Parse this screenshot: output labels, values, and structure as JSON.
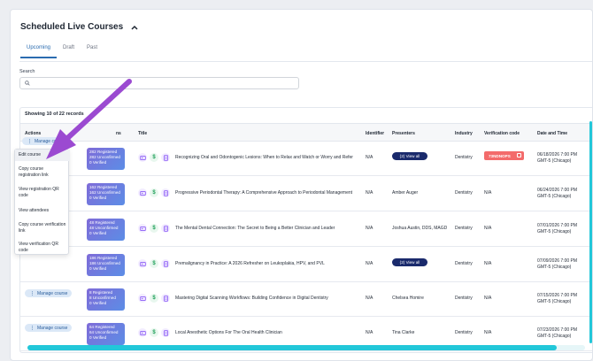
{
  "header": {
    "title": "Scheduled Live Courses"
  },
  "tabs": [
    {
      "label": "Upcoming"
    },
    {
      "label": "Draft"
    },
    {
      "label": "Past"
    }
  ],
  "search": {
    "label": "Search",
    "placeholder": ""
  },
  "table": {
    "showing": "Showing 10 of 22 records",
    "columns": [
      "Actions",
      "Title",
      "Identifier",
      "Presenters",
      "Industry",
      "Verification code",
      "Date and Time"
    ],
    "partial_header": "ns",
    "manage_label": "Manage course",
    "view_all_label": "(2) View all",
    "rows": [
      {
        "registered": "282 Registered",
        "unconfirmed": "282 Unconfirmed",
        "verified": "0 Verified",
        "title": "Recognizing Oral and Odontogenic Lesions: When to Relax and Watch or Worry and Refer",
        "identifier": "N/A",
        "presenters": "",
        "view_all": true,
        "industry": "Dentistry",
        "verification": "73NDNOPS",
        "verification_badge": true,
        "date": "06/18/2026 7:00 PM",
        "tz": "GMT-5 (Chicago)"
      },
      {
        "registered": "162 Registered",
        "unconfirmed": "162 Unconfirmed",
        "verified": "0 Verified",
        "title": "Progressive Periodontal Therapy: A Comprehensive Approach to Periodontal Management",
        "identifier": "N/A",
        "presenters": "Amber Auger",
        "view_all": false,
        "industry": "Dentistry",
        "verification": "N/A",
        "verification_badge": false,
        "date": "06/24/2026 7:00 PM",
        "tz": "GMT-5 (Chicago)"
      },
      {
        "registered": "48 Registered",
        "unconfirmed": "48 Unconfirmed",
        "verified": "0 Verified",
        "title": "The Mental Dental Connection: The Secret to Being a Better Clinician and Leader",
        "identifier": "N/A",
        "presenters": "Joshua Austin, DDS, MAGD",
        "view_all": false,
        "industry": "Dentistry",
        "verification": "N/A",
        "verification_badge": false,
        "date": "07/01/2026 7:00 PM",
        "tz": "GMT-5 (Chicago)"
      },
      {
        "registered": "186 Registered",
        "unconfirmed": "186 Unconfirmed",
        "verified": "0 Verified",
        "title": "Premalignancy in Practice: A 2026 Refresher on Leukoplakia, HPV, and PVL",
        "identifier": "N/A",
        "presenters": "",
        "view_all": true,
        "industry": "Dentistry",
        "verification": "N/A",
        "verification_badge": false,
        "date": "07/09/2026 7:00 PM",
        "tz": "GMT-5 (Chicago)"
      },
      {
        "registered": "8 Registered",
        "unconfirmed": "8 Unconfirmed",
        "verified": "0 Verified",
        "title": "Mastering Digital Scanning Workflows: Building Confidence in Digital Dentistry",
        "identifier": "N/A",
        "presenters": "Chelsea Homire",
        "view_all": false,
        "industry": "Dentistry",
        "verification": "N/A",
        "verification_badge": false,
        "date": "07/15/2026 7:00 PM",
        "tz": "GMT-5 (Chicago)"
      },
      {
        "registered": "64 Registered",
        "unconfirmed": "64 Unconfirmed",
        "verified": "0 Verified",
        "title": "Local Anesthetic Options For The Oral Health Clinician",
        "identifier": "N/A",
        "presenters": "Tina Clarke",
        "view_all": false,
        "industry": "Dentistry",
        "verification": "N/A",
        "verification_badge": false,
        "date": "07/23/2026 7:00 PM",
        "tz": "GMT-5 (Chicago)"
      }
    ]
  },
  "dropdown": {
    "items": [
      {
        "label": "Edit course"
      },
      {
        "label": "Copy course registration link"
      },
      {
        "label": "View registration QR code"
      },
      {
        "label": "View attendees"
      },
      {
        "label": "Copy course verification link"
      },
      {
        "label": "View verification QR code"
      }
    ]
  },
  "colors": {
    "accent": "#2b6cb0",
    "badge_gradient_start": "#7f6bd8",
    "badge_gradient_end": "#5c8de6",
    "arrow": "#9b4ad1",
    "scrollbar": "#22c7d9",
    "code_badge": "#f36b6b",
    "view_all": "#1a2a6c"
  }
}
